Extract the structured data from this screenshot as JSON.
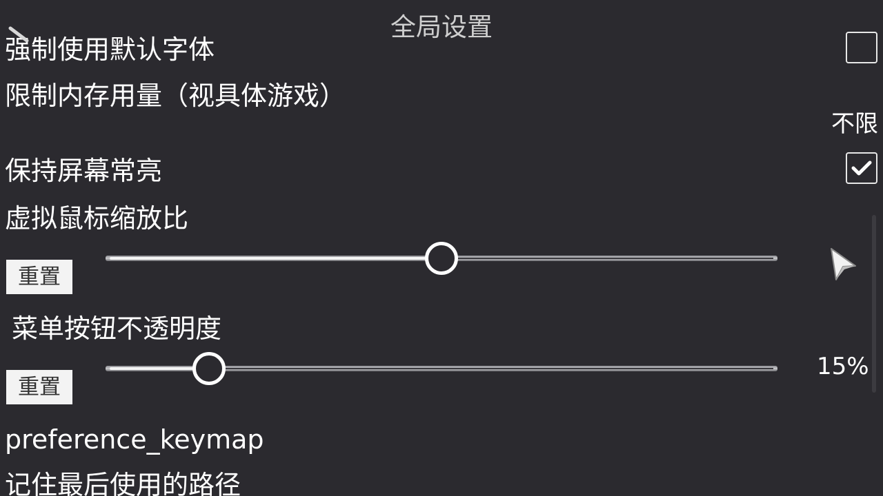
{
  "header": {
    "title": "全局设置"
  },
  "settings": {
    "force_default_font": {
      "label": "强制使用默认字体",
      "checked": false
    },
    "memory_limit": {
      "label": "限制内存用量（视具体游戏）",
      "value": "不限"
    },
    "keep_screen_on": {
      "label": "保持屏幕常亮",
      "checked": true
    },
    "mouse_scale": {
      "label": "虚拟鼠标缩放比",
      "reset_label": "重置",
      "level": 0.5
    },
    "menu_opacity": {
      "label": "菜单按钮不透明度",
      "reset_label": "重置",
      "value": "15%",
      "level": 0.15
    },
    "keymap": {
      "label": "preference_keymap"
    },
    "remember_path": {
      "label": "记住最后使用的路径"
    }
  },
  "icons": {
    "back": "pencil-back-icon",
    "cursor": "mouse-cursor-icon",
    "check": "checkmark-icon"
  },
  "colors": {
    "background": "#2b2a2f",
    "title_text": "#cfcfcf",
    "text": "#ffffff",
    "button_bg": "#f3f3f3"
  }
}
